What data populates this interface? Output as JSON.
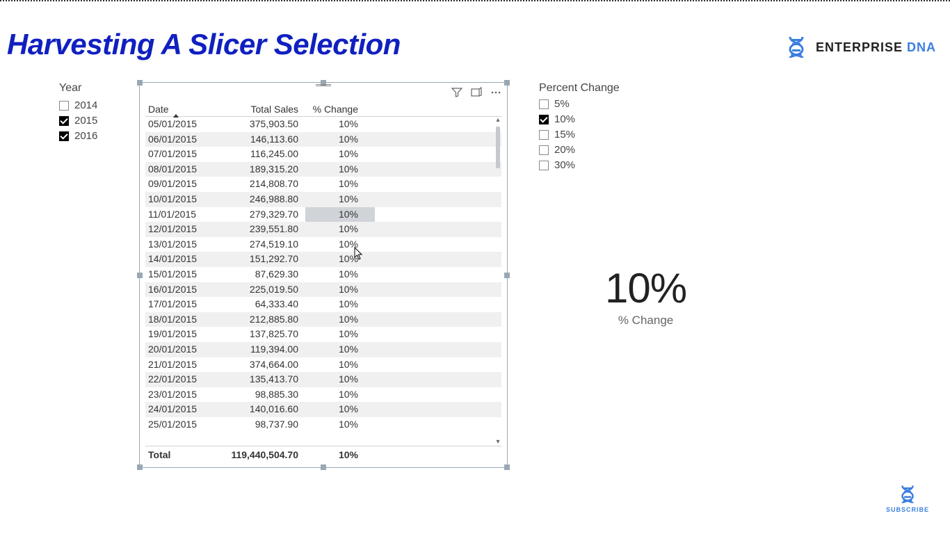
{
  "page_title": "Harvesting A Slicer Selection",
  "brand": {
    "name_a": "ENTERPRISE ",
    "name_b": "DNA"
  },
  "subscribe_label": "SUBSCRIBE",
  "year_slicer": {
    "title": "Year",
    "items": [
      {
        "label": "2014",
        "checked": false
      },
      {
        "label": "2015",
        "checked": true
      },
      {
        "label": "2016",
        "checked": true
      }
    ]
  },
  "percent_slicer": {
    "title": "Percent Change",
    "items": [
      {
        "label": "5%",
        "checked": false
      },
      {
        "label": "10%",
        "checked": true
      },
      {
        "label": "15%",
        "checked": false
      },
      {
        "label": "20%",
        "checked": false
      },
      {
        "label": "30%",
        "checked": false
      }
    ]
  },
  "card": {
    "value": "10%",
    "label": "% Change"
  },
  "table": {
    "columns": {
      "date": "Date",
      "sales": "Total Sales",
      "change": "% Change"
    },
    "rows": [
      {
        "date": "05/01/2015",
        "sales": "375,903.50",
        "change": "10%"
      },
      {
        "date": "06/01/2015",
        "sales": "146,113.60",
        "change": "10%"
      },
      {
        "date": "07/01/2015",
        "sales": "116,245.00",
        "change": "10%"
      },
      {
        "date": "08/01/2015",
        "sales": "189,315.20",
        "change": "10%"
      },
      {
        "date": "09/01/2015",
        "sales": "214,808.70",
        "change": "10%"
      },
      {
        "date": "10/01/2015",
        "sales": "246,988.80",
        "change": "10%"
      },
      {
        "date": "11/01/2015",
        "sales": "279,329.70",
        "change": "10%",
        "highlight_change": true
      },
      {
        "date": "12/01/2015",
        "sales": "239,551.80",
        "change": "10%"
      },
      {
        "date": "13/01/2015",
        "sales": "274,519.10",
        "change": "10%"
      },
      {
        "date": "14/01/2015",
        "sales": "151,292.70",
        "change": "10%"
      },
      {
        "date": "15/01/2015",
        "sales": "87,629.30",
        "change": "10%"
      },
      {
        "date": "16/01/2015",
        "sales": "225,019.50",
        "change": "10%"
      },
      {
        "date": "17/01/2015",
        "sales": "64,333.40",
        "change": "10%"
      },
      {
        "date": "18/01/2015",
        "sales": "212,885.80",
        "change": "10%"
      },
      {
        "date": "19/01/2015",
        "sales": "137,825.70",
        "change": "10%"
      },
      {
        "date": "20/01/2015",
        "sales": "119,394.00",
        "change": "10%"
      },
      {
        "date": "21/01/2015",
        "sales": "374,664.00",
        "change": "10%"
      },
      {
        "date": "22/01/2015",
        "sales": "135,413.70",
        "change": "10%"
      },
      {
        "date": "23/01/2015",
        "sales": "98,885.30",
        "change": "10%"
      },
      {
        "date": "24/01/2015",
        "sales": "140,016.60",
        "change": "10%"
      },
      {
        "date": "25/01/2015",
        "sales": "98,737.90",
        "change": "10%"
      }
    ],
    "footer": {
      "label": "Total",
      "sales": "119,440,504.70",
      "change": "10%"
    }
  }
}
